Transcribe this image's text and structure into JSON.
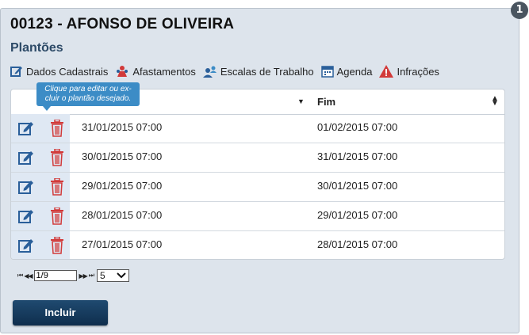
{
  "step_badge": "1",
  "title": "00123 - AFONSO DE OLIVEIRA",
  "section": "Plantões",
  "links": [
    {
      "label": "Dados Cadastrais",
      "icon": "edit-icon"
    },
    {
      "label": "Afastamentos",
      "icon": "people-red-icon"
    },
    {
      "label": "Escalas de Trabalho",
      "icon": "users-icon"
    },
    {
      "label": "Agenda",
      "icon": "calendar-icon"
    },
    {
      "label": "Infrações",
      "icon": "warning-icon"
    }
  ],
  "tooltip": "Clique para editar ou ex-cluir o plantão desejado.",
  "table": {
    "col_fim": "Fim",
    "rows": [
      {
        "inicio": "31/01/2015 07:00",
        "fim": "01/02/2015 07:00"
      },
      {
        "inicio": "30/01/2015 07:00",
        "fim": "31/01/2015 07:00"
      },
      {
        "inicio": "29/01/2015 07:00",
        "fim": "30/01/2015 07:00"
      },
      {
        "inicio": "28/01/2015 07:00",
        "fim": "29/01/2015 07:00"
      },
      {
        "inicio": "27/01/2015 07:00",
        "fim": "28/01/2015 07:00"
      }
    ]
  },
  "pager": {
    "page": "1/9",
    "page_size": "5"
  },
  "button_label": "Incluir",
  "colors": {
    "accent": "#2d4a67",
    "button": "#1a3f62",
    "tooltip": "#3c8cc6",
    "delete": "#d23a3a",
    "edit": "#2a5f9a"
  }
}
